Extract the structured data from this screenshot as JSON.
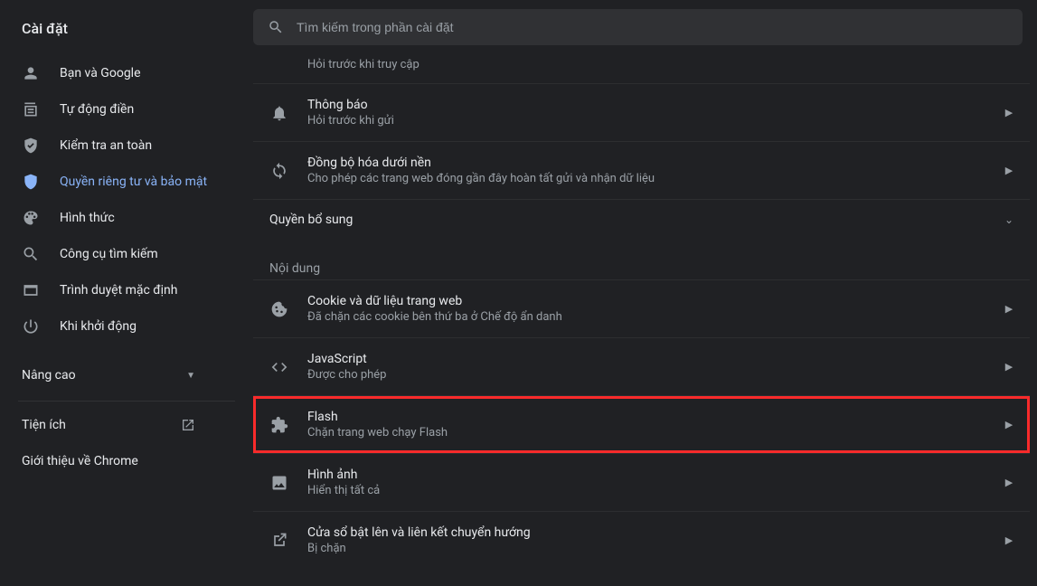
{
  "page_title": "Cài đặt",
  "search": {
    "placeholder": "Tìm kiếm trong phần cài đặt"
  },
  "sidebar": {
    "items": [
      {
        "label": "Bạn và Google",
        "icon": "person-icon"
      },
      {
        "label": "Tự động điền",
        "icon": "autofill-icon"
      },
      {
        "label": "Kiểm tra an toàn",
        "icon": "shield-check-icon"
      },
      {
        "label": "Quyền riêng tư và bảo mật",
        "icon": "shield-icon",
        "active": true
      },
      {
        "label": "Hình thức",
        "icon": "palette-icon"
      },
      {
        "label": "Công cụ tìm kiếm",
        "icon": "search-icon"
      },
      {
        "label": "Trình duyệt mặc định",
        "icon": "browser-icon"
      },
      {
        "label": "Khi khởi động",
        "icon": "power-icon"
      }
    ],
    "advanced_label": "Nâng cao",
    "extensions_label": "Tiện ích",
    "about_label": "Giới thiệu về Chrome"
  },
  "permissions_top": {
    "truncated_sub": "Hỏi trước khi truy cập",
    "rows": [
      {
        "title": "Thông báo",
        "sub": "Hỏi trước khi gửi",
        "icon": "bell-icon"
      },
      {
        "title": "Đồng bộ hóa dưới nền",
        "sub": "Cho phép các trang web đóng gần đây hoàn tất gửi và nhận dữ liệu",
        "icon": "sync-icon"
      }
    ]
  },
  "additional_permissions_label": "Quyền bổ sung",
  "content_section": {
    "title": "Nội dung",
    "rows": [
      {
        "title": "Cookie và dữ liệu trang web",
        "sub": "Đã chặn các cookie bên thứ ba ở Chế độ ẩn danh",
        "icon": "cookie-icon"
      },
      {
        "title": "JavaScript",
        "sub": "Được cho phép",
        "icon": "code-icon"
      },
      {
        "title": "Flash",
        "sub": "Chặn trang web chạy Flash",
        "icon": "plugin-icon",
        "highlighted": true
      },
      {
        "title": "Hình ảnh",
        "sub": "Hiển thị tất cả",
        "icon": "image-icon"
      },
      {
        "title": "Cửa sổ bật lên và liên kết chuyển hướng",
        "sub": "Bị chặn",
        "icon": "popup-icon"
      }
    ]
  }
}
